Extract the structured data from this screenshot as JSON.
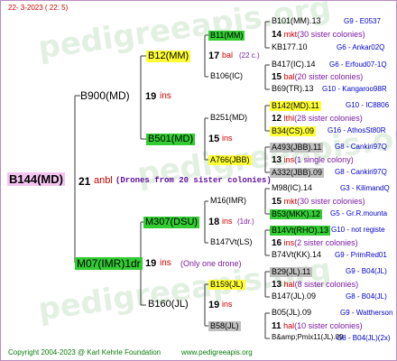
{
  "header": {
    "date": "22-  3-2023 ( 22:  5)"
  },
  "footer": {
    "copyright": "Copyright 2004-2023 @ Karl Kehrle Foundation",
    "site": "www.pedigreeapis.org"
  },
  "watermark": {
    "text": "pedigreeapis.org"
  },
  "colors": {
    "pink": "#f4c4f0",
    "yellow": "#ffff33",
    "green": "#33cc33",
    "gray": "#c0c0c0",
    "blue_text": "#0000cc",
    "red_text": "#cc0000"
  },
  "root": {
    "label": "B144(MD)",
    "num": "21",
    "code": "anbl",
    "note": "(Drones from 20 sister colonies)"
  },
  "gen2": [
    {
      "label": "B900(MD)",
      "num": "19",
      "code": "ins"
    },
    {
      "label": "M07(IMR)1dr",
      "num": "19",
      "code": "ins",
      "note": "(Only one drone)"
    }
  ],
  "gen3": [
    {
      "label": "B12(MM)",
      "num": "17",
      "code": "bal",
      "note": "(22 c.)"
    },
    {
      "label": "B501(MD)",
      "num": "15",
      "code": "ins"
    },
    {
      "label": "M307(DSU)",
      "num": "18",
      "code": "ins",
      "note": "(1dr.)"
    },
    {
      "label": "B160(JL)",
      "num": "19",
      "code": "ins"
    }
  ],
  "gen4": [
    {
      "label": "B11(MM)",
      "num": "14",
      "code": "mkt",
      "note": "(30 sister colonies)"
    },
    {
      "label": "B106(IC)"
    },
    {
      "label": "B251(MD)",
      "num": "12",
      "code": "lthl",
      "note": "(28 sister colonies)"
    },
    {
      "label": "A766(JBB)",
      "num": "13",
      "code": "ins",
      "note": "(1 single colony)"
    },
    {
      "label": "M16(IMR)",
      "num": "15",
      "code": "mkt",
      "note": "(30 sister colonies)"
    },
    {
      "label": "B147Vt(LS)",
      "num": "16",
      "code": "ins",
      "note": "(2 sister colonies)"
    },
    {
      "label": "B159(JL)",
      "num": "13",
      "code": "hal",
      "note": "(8 sister colonies)"
    },
    {
      "label": "B58(JL)",
      "num": "11",
      "code": "hal",
      "note": "(10 sister colonies)"
    }
  ],
  "gen5": [
    {
      "label": "B101(MM).13",
      "info": "G9 - E0537"
    },
    {
      "label": "KB177.10",
      "info": "G6 - Ankar02Q"
    },
    {
      "label": "B417(IC).14",
      "info": "G6 - Erfoud07-1Q"
    },
    {
      "label": "B69(TR).13",
      "info": "G10 - Kangaroo98R"
    },
    {
      "label": "B142(MD).11",
      "info": "G10 - IC8806"
    },
    {
      "label": "B34(CS).09",
      "info": "G16 - AthosSt80R"
    },
    {
      "label": "A493(JBB).11",
      "info": "G8 - Cankiri97Q"
    },
    {
      "label": "A332(JBB).09",
      "info": "G8 - Cankiri97Q"
    },
    {
      "label": "M98(IC).14",
      "info": "G3 - KilimandQ"
    },
    {
      "label": "B53(MKK).12",
      "info": "G5 - Gr.R.mounta"
    },
    {
      "label": "B14Vt(RHO).13",
      "info": "G10 - not registe"
    },
    {
      "label": "B74Vt(KK).14",
      "info": "G9 - PrimRed01"
    },
    {
      "label": "B29(JL).11",
      "info": "G9 - B04(JL)"
    },
    {
      "label": "B147(JL).09",
      "info": "G8 - B04(JL)"
    },
    {
      "label": "B05(JL).09",
      "info": "G9 - Wattherson"
    },
    {
      "label": "B&amp;Pmix11(JL).09",
      "info": "G8 - B04(JL)(2x)"
    }
  ]
}
